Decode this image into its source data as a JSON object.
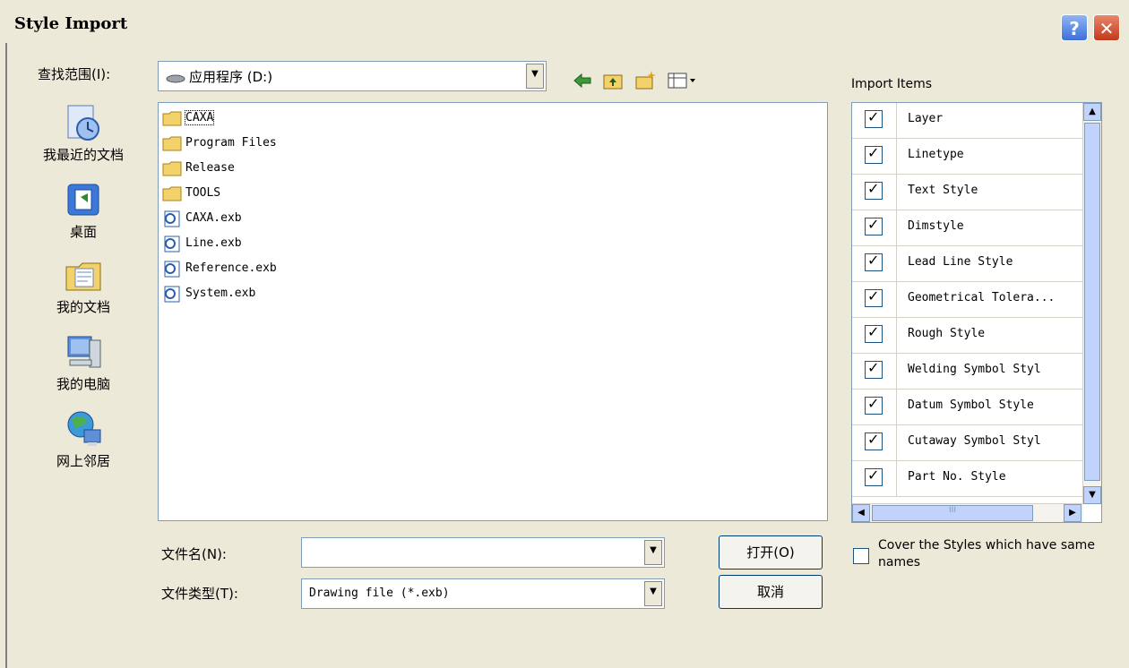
{
  "window": {
    "title": "Style Import",
    "help_label": "?",
    "close_label": "✕"
  },
  "lookin": {
    "label": "查找范围(I):",
    "value": "应用程序 (D:)",
    "arrow": "▼"
  },
  "toolbar": {
    "back_icon": "⇦",
    "up_icon": "up-folder-icon",
    "new_folder_icon": "new-folder-icon",
    "views_icon": "views-menu-icon"
  },
  "places": [
    {
      "label": "我最近的文档",
      "icon": "recent-documents-icon"
    },
    {
      "label": "桌面",
      "icon": "desktop-icon"
    },
    {
      "label": "我的文档",
      "icon": "my-documents-icon"
    },
    {
      "label": "我的电脑",
      "icon": "my-computer-icon"
    },
    {
      "label": "网上邻居",
      "icon": "network-places-icon"
    }
  ],
  "files": [
    {
      "name": "CAXA",
      "type": "folder"
    },
    {
      "name": "Program Files",
      "type": "folder"
    },
    {
      "name": "Release",
      "type": "folder"
    },
    {
      "name": "TOOLS",
      "type": "folder"
    },
    {
      "name": "CAXA.exb",
      "type": "exb"
    },
    {
      "name": "Line.exb",
      "type": "exb"
    },
    {
      "name": "Reference.exb",
      "type": "exb"
    },
    {
      "name": "System.exb",
      "type": "exb"
    }
  ],
  "filename": {
    "label": "文件名(N):",
    "value": ""
  },
  "filetype": {
    "label": "文件类型(T):",
    "value": "Drawing file (*.exb)"
  },
  "buttons": {
    "open": "打开(O)",
    "cancel": "取消"
  },
  "import_items": {
    "label": "Import Items",
    "check_mark": "✓",
    "items": [
      {
        "name": "Layer",
        "checked": true
      },
      {
        "name": "Linetype",
        "checked": true
      },
      {
        "name": "Text Style",
        "checked": true
      },
      {
        "name": "Dimstyle",
        "checked": true
      },
      {
        "name": "Lead Line Style",
        "checked": true
      },
      {
        "name": "Geometrical Tolera...",
        "checked": true
      },
      {
        "name": "Rough Style",
        "checked": true
      },
      {
        "name": "Welding Symbol Styl",
        "checked": true
      },
      {
        "name": "Datum Symbol Style",
        "checked": true
      },
      {
        "name": "Cutaway Symbol Styl",
        "checked": true
      },
      {
        "name": "Part No. Style",
        "checked": true
      }
    ],
    "scroll_up": "▲",
    "scroll_down": "▼",
    "scroll_left": "◀",
    "scroll_right": "▶",
    "grip": "III"
  },
  "cover": {
    "label": "Cover the Styles which have same names",
    "checked": false
  }
}
